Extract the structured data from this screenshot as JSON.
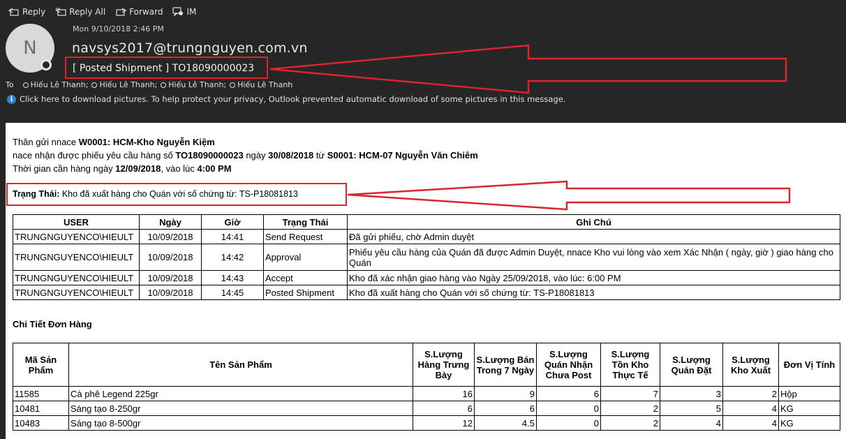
{
  "toolbar": {
    "reply": "Reply",
    "reply_all": "Reply All",
    "forward": "Forward",
    "im": "IM"
  },
  "message": {
    "avatar_initial": "N",
    "date": "Mon 9/10/2018 2:46 PM",
    "sender": "navsys2017@trungnguyen.com.vn",
    "subject": "[ Posted Shipment ] TO18090000023",
    "to_label": "To",
    "recipients": [
      "Hiếu Lê Thanh;",
      "Hiếu Lê Thanh;",
      "Hiếu Lê Thanh;",
      "Hiếu Lê Thanh"
    ],
    "download_notice": "Click here to download pictures. To help protect your privacy, Outlook prevented automatic download of some pictures in this message."
  },
  "body": {
    "l1a": "Thân gửi nnace ",
    "l1b": "W0001: HCM-Kho Nguyễn Kiệm",
    "l2a": "nace nhận được phiếu yêu cầu hàng số ",
    "l2b": "TO18090000023",
    "l2c": " ngày ",
    "l2d": "30/08/2018",
    "l2e": " từ ",
    "l2f": "S0001: HCM-07 Nguyễn Văn Chiêm",
    "l3a": "Thời gian cần hàng ngày ",
    "l3b": "12/09/2018",
    "l3c": ", vào lúc ",
    "l3d": "4:00 PM",
    "status_label": "Trạng Thái:",
    "status_text": " Kho đã xuất hàng cho Quán với số chứng từ: TS-P18081813",
    "section_title": "Chi Tiết Đơn Hàng"
  },
  "log_table": {
    "headers": [
      "USER",
      "Ngày",
      "Giờ",
      "Trạng Thái",
      "Ghi Chú"
    ],
    "rows": [
      [
        "TRUNGNGUYENCO\\HIEULT",
        "10/09/2018",
        "14:41",
        "Send Request",
        "Đã gửi phiếu, chờ Admin duyệt"
      ],
      [
        "TRUNGNGUYENCO\\HIEULT",
        "10/09/2018",
        "14:42",
        "Approval",
        "Phiếu yêu cầu hàng của Quán đã được Admin Duyệt, nnace Kho vui lòng vào xem Xác Nhận ( ngày, giờ ) giao hàng cho Quán"
      ],
      [
        "TRUNGNGUYENCO\\HIEULT",
        "10/09/2018",
        "14:43",
        "Accept",
        "Kho đã xác nhận giao hàng vào Ngày 25/09/2018, vào lúc: 6:00 PM"
      ],
      [
        "TRUNGNGUYENCO\\HIEULT",
        "10/09/2018",
        "14:45",
        "Posted Shipment",
        "Kho đã xuất hàng cho Quán với số chứng từ: TS-P18081813"
      ]
    ]
  },
  "detail_table": {
    "headers": [
      "Mã Sản Phẩm",
      "Tên Sản Phẩm",
      "S.Lượng Hàng Trưng Bày",
      "S.Lượng Bán Trong 7 Ngày",
      "S.Lượng Quán Nhận Chưa Post",
      "S.Lượng Tồn Kho Thực Tế",
      "S.Lượng Quán Đặt",
      "S.Lượng Kho Xuất",
      "Đơn Vị Tính"
    ],
    "rows": [
      [
        "11585",
        "Cà phê Legend 225gr",
        "16",
        "9",
        "6",
        "7",
        "3",
        "2",
        "Hộp"
      ],
      [
        "10481",
        "Sáng tạo 8-250gr",
        "6",
        "6",
        "0",
        "2",
        "5",
        "4",
        "KG"
      ],
      [
        "10483",
        "Sáng tạo 8-500gr",
        "12",
        "4.5",
        "0",
        "2",
        "4",
        "4",
        "KG"
      ]
    ]
  },
  "colors": {
    "header_bg": "#262626",
    "annotation_red": "#d9252b",
    "info_blue": "#2f7fd1"
  }
}
